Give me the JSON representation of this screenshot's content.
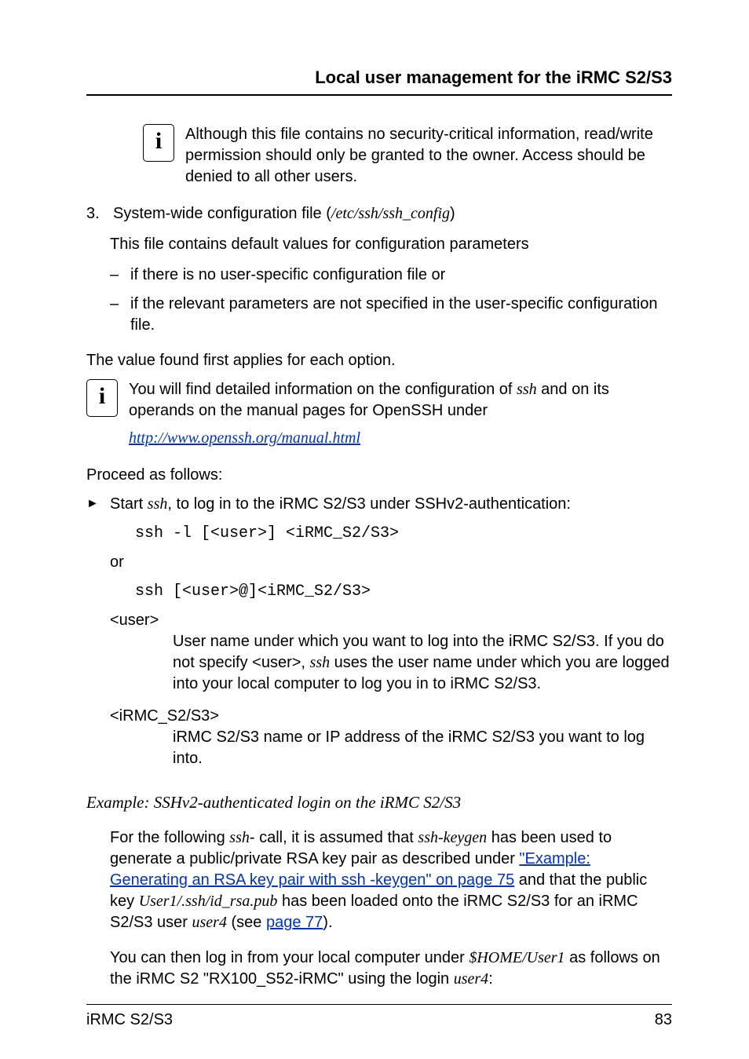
{
  "header": {
    "title": "Local user management for the iRMC S2/S3"
  },
  "info1": {
    "text": "Although this file contains no security-critical information, read/write permission should only be granted to the owner. Access should be denied to all other users."
  },
  "list3": {
    "num": "3.",
    "text_before": "System-wide configuration file (",
    "text_italic": "/etc/ssh/ssh_config",
    "text_after": ")"
  },
  "list3_sub": {
    "intro": "This file contains default values for configuration parameters",
    "d1": "if there is no user-specific configuration file or",
    "d2": "if the relevant parameters are not specified in the user-specific configuration file."
  },
  "value_found": "The value found first applies for each option.",
  "info2": {
    "line1a": "You will find detailed information on the configuration of ",
    "line1b_it": "ssh",
    "line1c": " and on its operands on the manual pages for OpenSSH under",
    "link": "http://www.openssh.org/manual.html"
  },
  "proceed": "Proceed as follows:",
  "tri": {
    "a": "Start ",
    "b_it": "ssh",
    "c": ", to log in to the iRMC S2/S3 under SSHv2-authentication:"
  },
  "cmd1": "ssh -l [<user>] <iRMC_S2/S3>",
  "or": "or",
  "cmd2": "ssh [<user>@]<iRMC_S2/S3>",
  "def_user": {
    "term": "<user>",
    "body_a": "User name under which you want to log into the iRMC S2/S3. If you do not specify <user>, ",
    "body_b_it": "ssh",
    "body_c": " uses the user name under which you are logged into your local computer to log you in to iRMC S2/S3."
  },
  "def_irmc": {
    "term": "<iRMC_S2/S3>",
    "body": "iRMC S2/S3 name or IP address of the iRMC S2/S3 you want to log into."
  },
  "example_heading": "Example: SSHv2-authenticated login on the iRMC S2/S3",
  "example_p1": {
    "a": "For the following ",
    "b_it": "ssh",
    "c": "- call, it is assumed that ",
    "d_it": "ssh-keygen",
    "e": " has been used to generate a public/private RSA key pair as described under ",
    "f_link": "\"Example: Generating an RSA key pair with ssh -keygen\" on page 75",
    "g": " and that the public key ",
    "h_it": "User1/.ssh/id_rsa.pub",
    "i": " has been loaded onto the iRMC S2/S3 for an iRMC S2/S3 user ",
    "j_it": "user4",
    "k": " (see ",
    "l_link": "page 77",
    "m": ")."
  },
  "example_p2": {
    "a": "You can then log in from your local computer under ",
    "b_it": "$HOME/User1",
    "c": " as follows on the iRMC S2 \"RX100_S52-iRMC\" using the login ",
    "d_it": "user4",
    "e": ":"
  },
  "footer": {
    "left": "iRMC S2/S3",
    "right": "83"
  }
}
